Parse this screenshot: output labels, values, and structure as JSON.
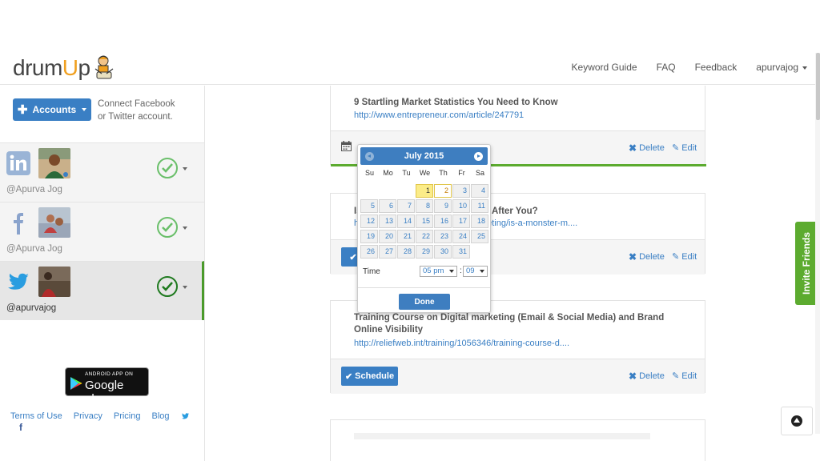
{
  "brand": {
    "logo_text_pre": "drum",
    "logo_text_u": "U",
    "logo_text_post": "p"
  },
  "nav": {
    "keyword_guide": "Keyword Guide",
    "faq": "FAQ",
    "feedback": "Feedback",
    "user": "apurvajog"
  },
  "sidebar": {
    "accounts_label": "Accounts",
    "connect_text": "Connect Facebook or Twitter account.",
    "accounts": [
      {
        "network": "linkedin",
        "handle": "@Apurva Jog",
        "active": false
      },
      {
        "network": "facebook",
        "handle": "@Apurva Jog",
        "active": false
      },
      {
        "network": "twitter",
        "handle": "@apurvajog",
        "active": true
      }
    ],
    "google_play_small": "ANDROID APP ON",
    "google_play_big": "Google play",
    "footer": {
      "terms": "Terms of Use",
      "privacy": "Privacy",
      "pricing": "Pricing",
      "blog": "Blog"
    }
  },
  "cards": [
    {
      "title": "9 Startling Market Statistics You Need to Know",
      "link": "http://www.entrepreneur.com/article/247791",
      "delete": "Delete",
      "edit": "Edit"
    },
    {
      "title_visible_start": "Is",
      "title_visible_end": "ly After You?",
      "link_visible_start": "h",
      "link_visible_end": "eting/is-a-monster-m....",
      "delete": "Delete",
      "edit": "Edit"
    },
    {
      "title": "Training Course on Digital marketing (Email & Social Media) and Brand Online Visibility",
      "link": "http://reliefweb.int/training/1056346/training-course-d....",
      "schedule": "Schedule",
      "delete": "Delete",
      "edit": "Edit"
    }
  ],
  "datepicker": {
    "month_label": "July 2015",
    "dows": [
      "Su",
      "Mo",
      "Tu",
      "We",
      "Th",
      "Fr",
      "Sa"
    ],
    "leading_blanks": 3,
    "days": [
      1,
      2,
      3,
      4,
      5,
      6,
      7,
      8,
      9,
      10,
      11,
      12,
      13,
      14,
      15,
      16,
      17,
      18,
      19,
      20,
      21,
      22,
      23,
      24,
      25,
      26,
      27,
      28,
      29,
      30,
      31
    ],
    "today": 1,
    "highlighted": 2,
    "time_label": "Time",
    "hour": "05 pm",
    "minute": "09",
    "separator": ":",
    "done_label": "Done"
  },
  "invite_label": "Invite Friends",
  "colors": {
    "primary": "#3a7fc4",
    "green": "#5cab2f",
    "brand_accent": "#f0a020"
  }
}
